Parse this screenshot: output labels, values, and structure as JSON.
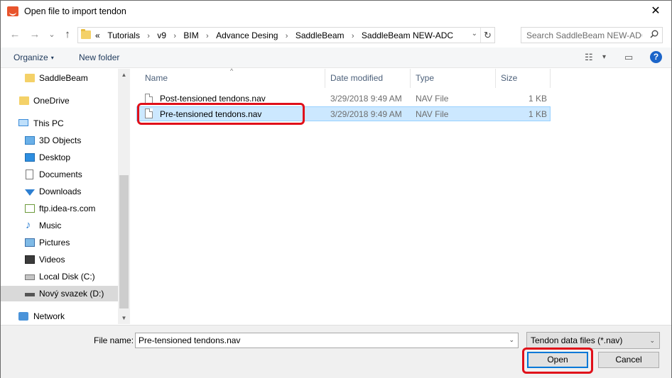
{
  "window": {
    "title": "Open file to import tendon",
    "close_glyph": "✕"
  },
  "navigation": {
    "back_glyph": "←",
    "forward_glyph": "→",
    "recent_glyph": "⌄",
    "up_glyph": "↑"
  },
  "address_bar": {
    "overflow": "«",
    "crumbs": [
      "Tutorials",
      "v9",
      "BIM",
      "Advance Desing",
      "SaddleBeam",
      "SaddleBeam NEW-ADC"
    ],
    "separator": "›",
    "dropdown_glyph": "⌄",
    "refresh_glyph": "↻"
  },
  "search": {
    "placeholder": "Search SaddleBeam NEW-ADC",
    "icon": "search-icon"
  },
  "toolbar": {
    "organize_label": "Organize",
    "new_folder_label": "New folder",
    "view_glyph": "☷",
    "view_caret": "▾",
    "preview_glyph": "▭",
    "help_glyph": "?"
  },
  "sidebar": {
    "items": [
      {
        "label": "SaddleBeam",
        "icon": "folder-icon"
      },
      {
        "label": "OneDrive",
        "icon": "onedrive-folder-icon"
      },
      {
        "label": "This PC",
        "icon": "computer-icon"
      },
      {
        "label": "3D Objects",
        "icon": "3d-objects-icon"
      },
      {
        "label": "Desktop",
        "icon": "desktop-icon"
      },
      {
        "label": "Documents",
        "icon": "documents-icon"
      },
      {
        "label": "Downloads",
        "icon": "downloads-icon"
      },
      {
        "label": "ftp.idea-rs.com",
        "icon": "network-location-icon"
      },
      {
        "label": "Music",
        "icon": "music-icon"
      },
      {
        "label": "Pictures",
        "icon": "pictures-icon"
      },
      {
        "label": "Videos",
        "icon": "videos-icon"
      },
      {
        "label": "Local Disk (C:)",
        "icon": "local-disk-icon"
      },
      {
        "label": "Nový svazek (D:)",
        "icon": "drive-icon"
      },
      {
        "label": "Network",
        "icon": "network-icon"
      }
    ],
    "selected": "Nový svazek (D:)"
  },
  "file_list": {
    "columns": {
      "name": "Name",
      "date": "Date modified",
      "type": "Type",
      "size": "Size"
    },
    "sort_glyph": "^",
    "rows": [
      {
        "name": "Post-tensioned tendons.nav",
        "date": "3/29/2018 9:49 AM",
        "type": "NAV File",
        "size": "1 KB"
      },
      {
        "name": "Pre-tensioned tendons.nav",
        "date": "3/29/2018 9:49 AM",
        "type": "NAV File",
        "size": "1 KB"
      }
    ],
    "selected": "Pre-tensioned tendons.nav"
  },
  "footer": {
    "file_name_label": "File name:",
    "file_name_value": "Pre-tensioned tendons.nav",
    "file_type_value": "Tendon data files (*.nav)",
    "dropdown_glyph": "⌄",
    "open_label": "Open",
    "cancel_label": "Cancel"
  },
  "scrollbar": {
    "up_glyph": "▲",
    "down_glyph": "▼"
  },
  "colors": {
    "highlight_outline": "#e0101a",
    "selection_bg": "#cce8ff",
    "accent": "#0078d7"
  }
}
